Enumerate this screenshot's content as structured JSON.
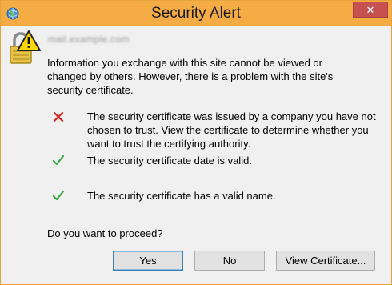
{
  "window": {
    "title": "Security Alert",
    "close_glyph": "✕"
  },
  "alert": {
    "site_url": "mail.example.com",
    "intro": "Information you exchange with this site cannot be viewed or changed by others. However, there is a problem with the site's security certificate.",
    "items": [
      {
        "status": "error",
        "icon": "red-x-icon",
        "text": "The security certificate was issued by a company you have not chosen to trust. View the certificate to determine whether you want to trust the certifying authority."
      },
      {
        "status": "ok",
        "icon": "green-check-icon",
        "text": "The security certificate date is valid."
      },
      {
        "status": "ok",
        "icon": "green-check-icon",
        "text": "The security certificate has a valid name."
      }
    ],
    "question": "Do you want to proceed?"
  },
  "buttons": {
    "yes": "Yes",
    "no": "No",
    "view_certificate": "View Certificate..."
  },
  "colors": {
    "titlebar": "#f5ac45",
    "close_button": "#c75050",
    "error": "#e02020",
    "ok": "#3aa845"
  }
}
